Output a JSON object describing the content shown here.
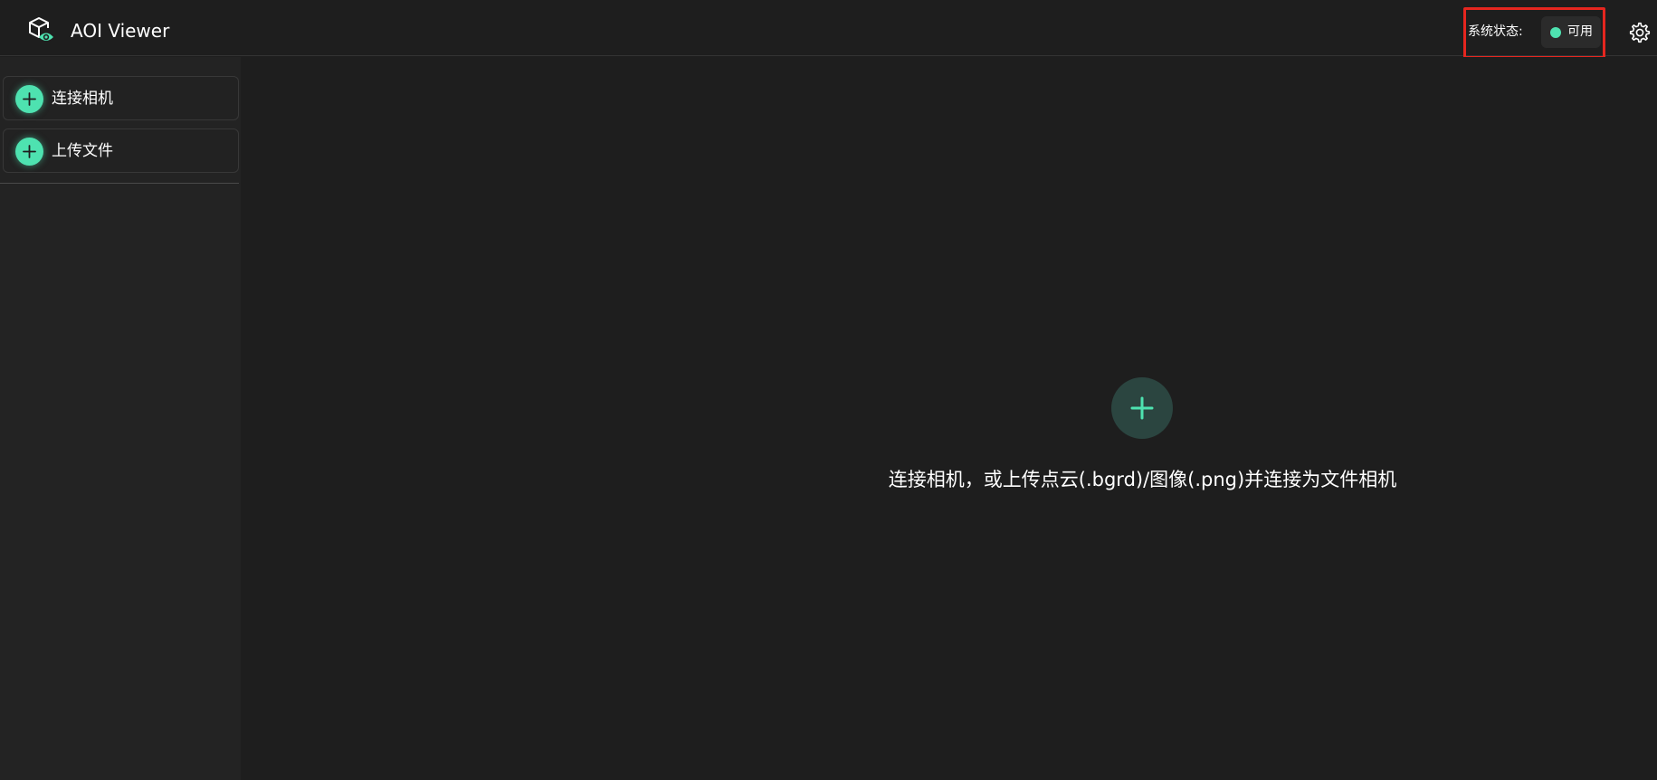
{
  "header": {
    "title": "AOI Viewer",
    "logo_icon": "cube-eye-icon",
    "status_label": "系统状态:",
    "status_value": "可用",
    "status_color": "#4ee2b0",
    "settings_icon": "gear-icon"
  },
  "sidebar": {
    "items": [
      {
        "label": "连接相机",
        "icon": "plus-icon"
      },
      {
        "label": "上传文件",
        "icon": "plus-icon"
      }
    ]
  },
  "main": {
    "add_icon": "plus-icon",
    "hint": "连接相机，或上传点云(.bgrd)/图像(.png)并连接为文件相机"
  },
  "colors": {
    "accent": "#4ee2b0",
    "background": "#1e1e1e",
    "highlight_border": "#e5261f"
  }
}
